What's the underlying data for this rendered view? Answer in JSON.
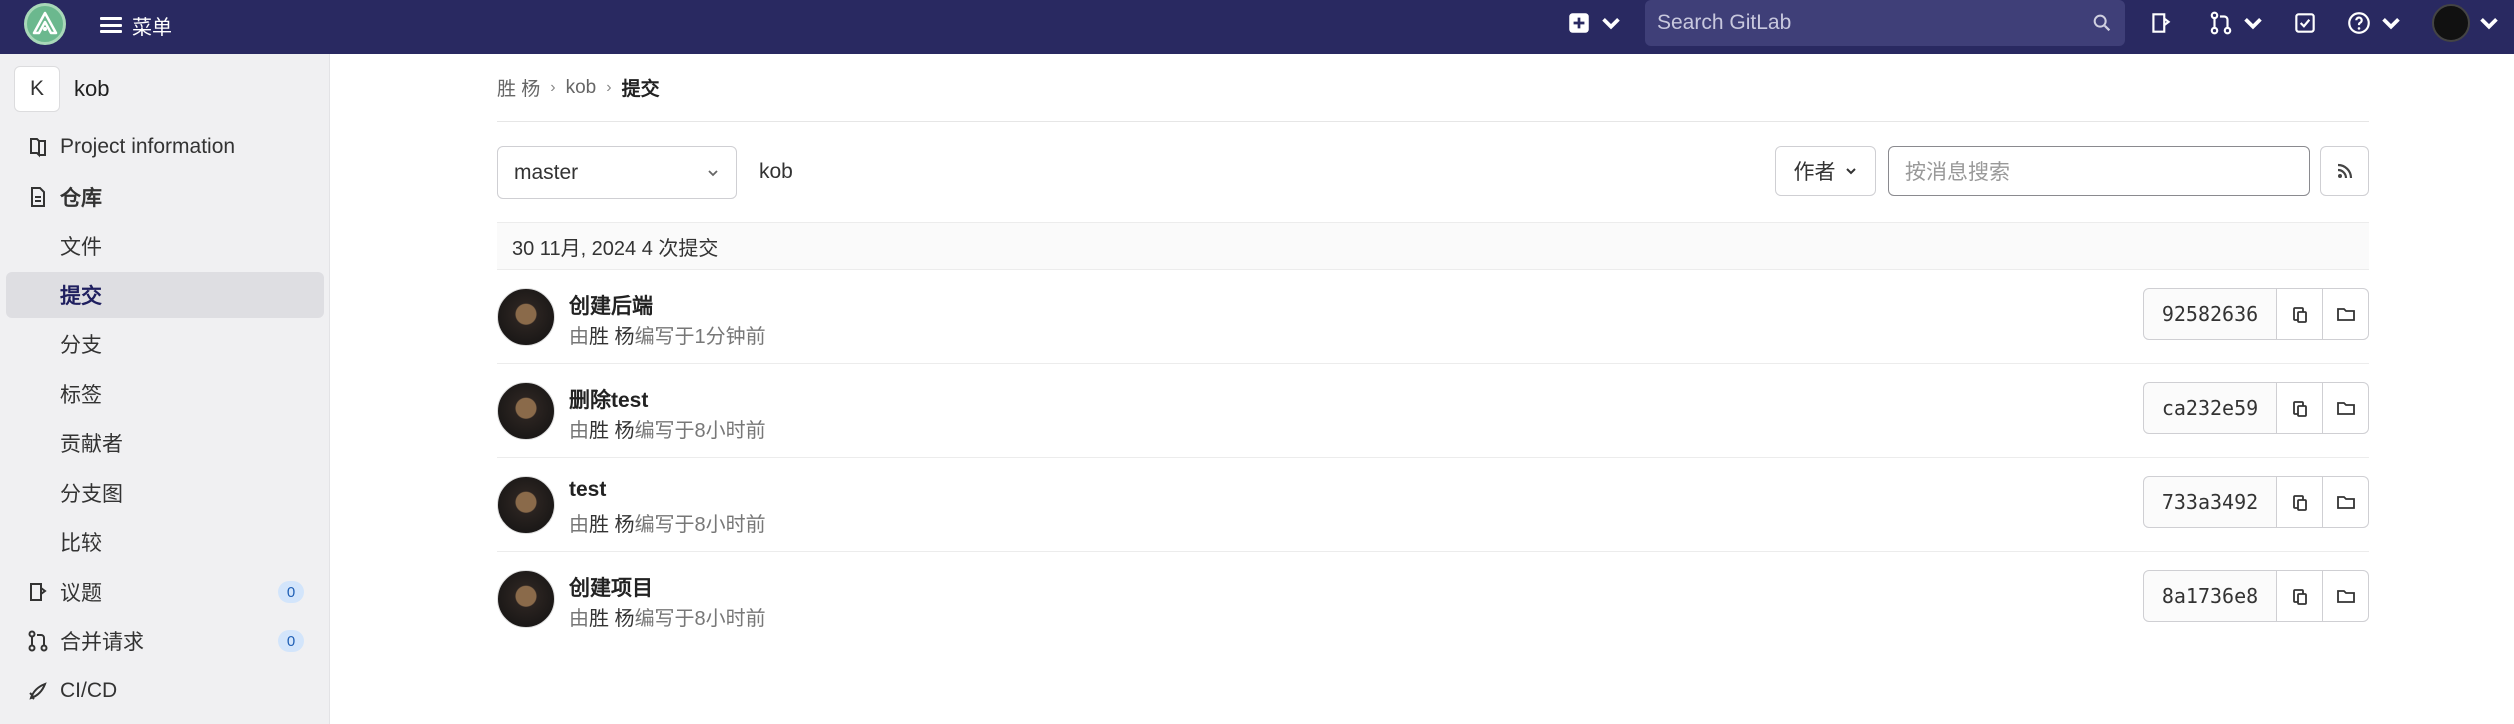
{
  "topbar": {
    "menu_label": "菜单",
    "search_placeholder": "Search GitLab"
  },
  "sidebar": {
    "project_initial": "K",
    "project_name": "kob",
    "items": [
      {
        "label": "Project information",
        "icon": "book-icon"
      },
      {
        "label": "仓库",
        "icon": "document-icon"
      },
      {
        "label": "文件"
      },
      {
        "label": "提交"
      },
      {
        "label": "分支"
      },
      {
        "label": "标签"
      },
      {
        "label": "贡献者"
      },
      {
        "label": "分支图"
      },
      {
        "label": "比较"
      },
      {
        "label": "议题",
        "icon": "issues-icon",
        "count": "0"
      },
      {
        "label": "合并请求",
        "icon": "merge-request-icon",
        "count": "0"
      },
      {
        "label": "CI/CD",
        "icon": "rocket-icon"
      }
    ]
  },
  "breadcrumb": {
    "user": "胜 杨",
    "project": "kob",
    "current": "提交"
  },
  "toolbar": {
    "branch": "master",
    "path": "kob",
    "author_label": "作者",
    "search_placeholder": "按消息搜索"
  },
  "day_header": "30 11月, 2024 4 次提交",
  "commits": [
    {
      "title": "创建后端",
      "by": "由",
      "author": "胜 杨",
      "written": "编写于1分钟前",
      "sha": "92582636"
    },
    {
      "title": "删除test",
      "by": "由",
      "author": "胜 杨",
      "written": "编写于8小时前",
      "sha": "ca232e59"
    },
    {
      "title": "test",
      "by": "由",
      "author": "胜 杨",
      "written": "编写于8小时前",
      "sha": "733a3492"
    },
    {
      "title": "创建项目",
      "by": "由",
      "author": "胜 杨",
      "written": "编写于8小时前",
      "sha": "8a1736e8"
    }
  ],
  "colors": {
    "navbar": "#292961",
    "sidebar": "#f0f0f2",
    "active_item": "#dedee2",
    "badge": "#d3e5fb"
  }
}
